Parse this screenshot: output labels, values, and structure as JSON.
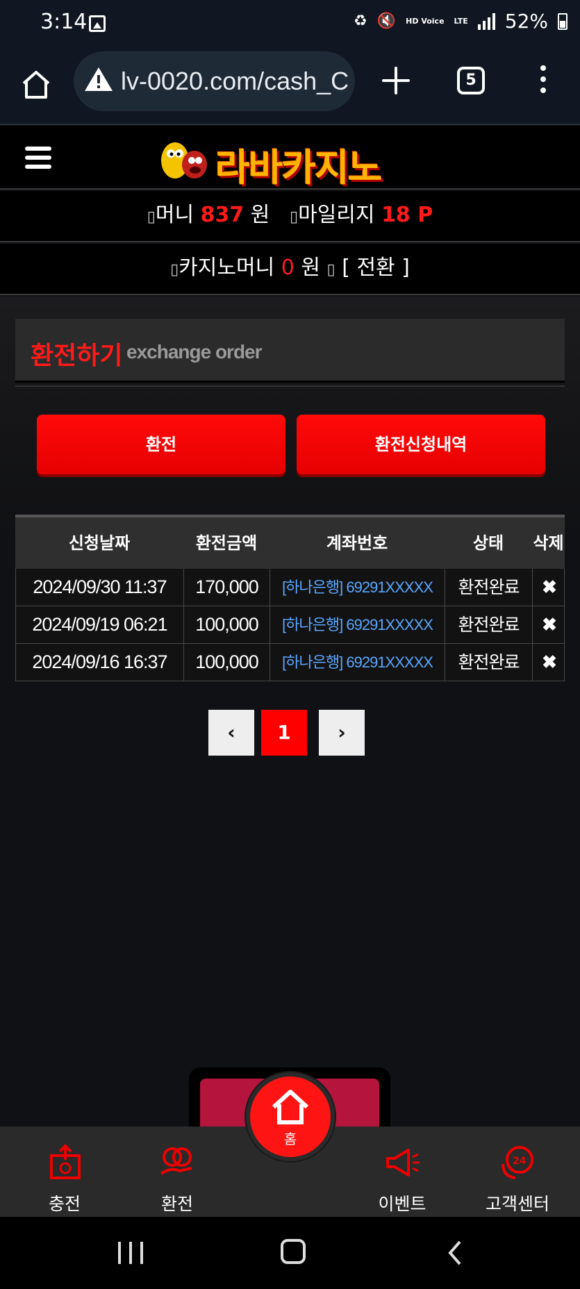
{
  "status_bar": {
    "time": "3:14",
    "battery": "52%",
    "network": "LTE",
    "hd_voice": "HD Voice"
  },
  "browser": {
    "url": "lv-0020.com/cash_C",
    "tab_count": "5"
  },
  "header": {
    "logo_text": "라바카지노"
  },
  "wallet": {
    "money_label": "머니",
    "money_value": "837",
    "money_unit": "원",
    "mileage_label": "마일리지",
    "mileage_value": "18 P",
    "casino_label": "카지노머니",
    "casino_value": "0",
    "casino_unit": "원",
    "convert_label": "[ 전환 ]"
  },
  "section": {
    "title_ko": "환전하기",
    "title_en": "exchange order"
  },
  "buttons": {
    "exchange": "환전",
    "history": "환전신청내역"
  },
  "table": {
    "headers": [
      "신청날짜",
      "환전금액",
      "계좌번호",
      "상태",
      "삭제"
    ],
    "rows": [
      {
        "date": "2024/09/30 11:37",
        "amount": "170,000",
        "account": "[하나은행] 69291XXXXX",
        "status": "환전완료"
      },
      {
        "date": "2024/09/19 06:21",
        "amount": "100,000",
        "account": "[하나은행] 69291XXXXX",
        "status": "환전완료"
      },
      {
        "date": "2024/09/16 16:37",
        "amount": "100,000",
        "account": "[하나은행] 69291XXXXX",
        "status": "환전완료"
      }
    ],
    "delete_symbol": "✖"
  },
  "pagination": {
    "current": "1",
    "prev": "‹",
    "next": "›"
  },
  "bottom_nav": {
    "items": [
      "충전",
      "환전",
      "홈",
      "이벤트",
      "고객센터"
    ]
  },
  "colors": {
    "accent": "#ff1a1a",
    "link": "#5aa7ff",
    "background": "#101114"
  }
}
